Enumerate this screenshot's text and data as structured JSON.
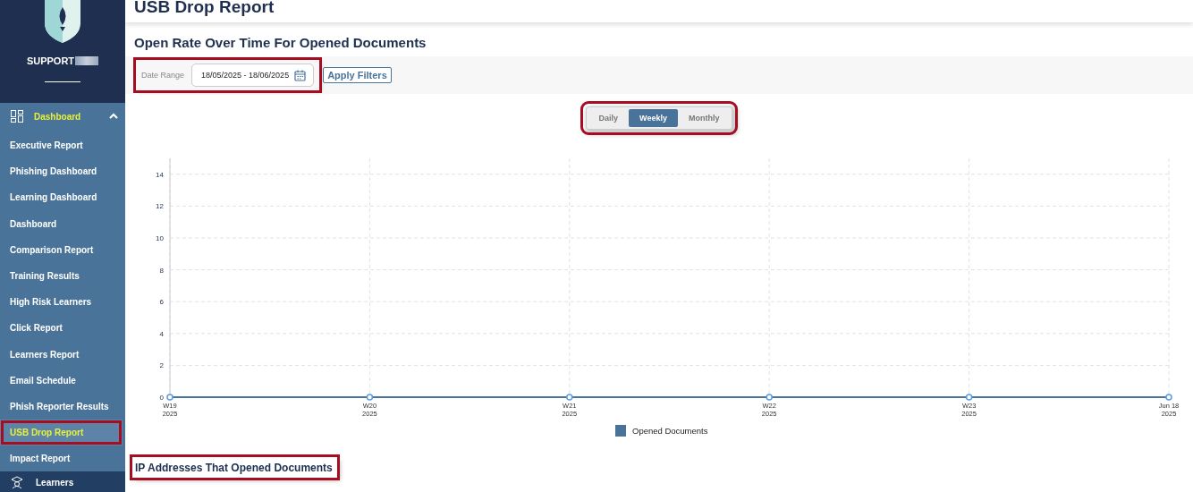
{
  "sidebar": {
    "user": "SUPPORT",
    "group": {
      "label": "Dashboard",
      "expanded": true
    },
    "items": [
      {
        "label": "Executive Report",
        "selected": false,
        "highlighted": false
      },
      {
        "label": "Phishing Dashboard",
        "selected": false,
        "highlighted": false
      },
      {
        "label": "Learning Dashboard",
        "selected": false,
        "highlighted": false
      },
      {
        "label": "Dashboard",
        "selected": false,
        "highlighted": false
      },
      {
        "label": "Comparison Report",
        "selected": false,
        "highlighted": false
      },
      {
        "label": "Training Results",
        "selected": false,
        "highlighted": false
      },
      {
        "label": "High Risk Learners",
        "selected": false,
        "highlighted": false
      },
      {
        "label": "Click Report",
        "selected": false,
        "highlighted": false
      },
      {
        "label": "Learners Report",
        "selected": false,
        "highlighted": false
      },
      {
        "label": "Email Schedule",
        "selected": false,
        "highlighted": false
      },
      {
        "label": "Phish Reporter Results",
        "selected": false,
        "highlighted": false
      },
      {
        "label": "USB Drop Report",
        "selected": true,
        "highlighted": true
      },
      {
        "label": "Impact Report",
        "selected": false,
        "highlighted": false
      }
    ],
    "next_group": {
      "label": "Learners"
    }
  },
  "page": {
    "title": "USB Drop Report"
  },
  "section": {
    "title": "Open Rate Over Time For Opened Documents",
    "filters": {
      "label": "Date Range",
      "value": "18/05/2025 - 18/06/2025",
      "highlighted": true,
      "button": "Apply Filters"
    },
    "period_toggle": {
      "highlighted": true,
      "options": [
        {
          "label": "Daily",
          "selected": false
        },
        {
          "label": "Weekly",
          "selected": true
        },
        {
          "label": "Monthly",
          "selected": false
        }
      ]
    },
    "chart_data": {
      "type": "line",
      "grid": true,
      "ylim": [
        0,
        15
      ],
      "categories": [
        "W19\n2025",
        "W20\n2025",
        "W21\n2025",
        "W22\n2025",
        "W23\n2025",
        "Jun 18\n2025"
      ],
      "yticks": [
        0,
        2,
        4,
        6,
        8,
        10,
        12,
        14
      ],
      "series": [
        {
          "name": "Opened Documents",
          "color": "#4a7399",
          "marker": "circle",
          "values": [
            0,
            0,
            0,
            0,
            0,
            0
          ]
        }
      ]
    }
  },
  "next_section": {
    "title": "IP Addresses That Opened Documents",
    "highlighted": true
  }
}
